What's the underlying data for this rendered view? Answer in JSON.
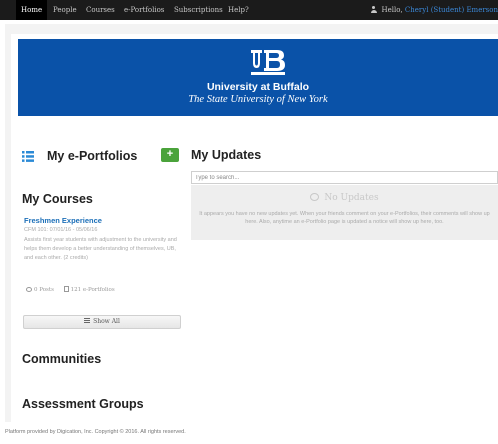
{
  "nav": {
    "items": [
      "Home",
      "People",
      "Courses",
      "e-Portfolios",
      "Subscriptions",
      "Help?"
    ],
    "greeting": "Hello, ",
    "user_name": "Cheryl (Student) Emerson"
  },
  "banner": {
    "title": "University at Buffalo",
    "subtitle": "The State University of New York"
  },
  "eportfolios": {
    "title": "My e-Portfolios",
    "add_label": "+"
  },
  "courses": {
    "title": "My Courses",
    "items": [
      {
        "name": "Freshmen Experience",
        "meta": "CFM 101: 07/01/16 - 05/06/16",
        "description": "Assists first year students with adjustment to the university and helps them develop a better understanding of themselves, UB, and each other. (2 credits)",
        "posts": "0 Posts",
        "eportfolios": "121 e-Portfolios"
      }
    ],
    "show_all_label": "Show All"
  },
  "communities": {
    "title": "Communities"
  },
  "assessment": {
    "title": "Assessment Groups"
  },
  "updates": {
    "title": "My Updates",
    "search_placeholder": "Type to search...",
    "empty_title": "No Updates",
    "empty_text": "It appears you have no new updates yet. When your friends comment on your e-Portfolios, their comments will show up here. Also, anytime an e-Portfolio page is updated a notice will show up here, too."
  },
  "footer": {
    "text": "Platform provided by Digication, Inc. Copyright © 2016. All rights reserved."
  },
  "colors": {
    "banner": "#0a52a8",
    "link": "#1c6fb8",
    "add_button": "#4aa33b",
    "nav_bg": "#1b1b1b"
  }
}
